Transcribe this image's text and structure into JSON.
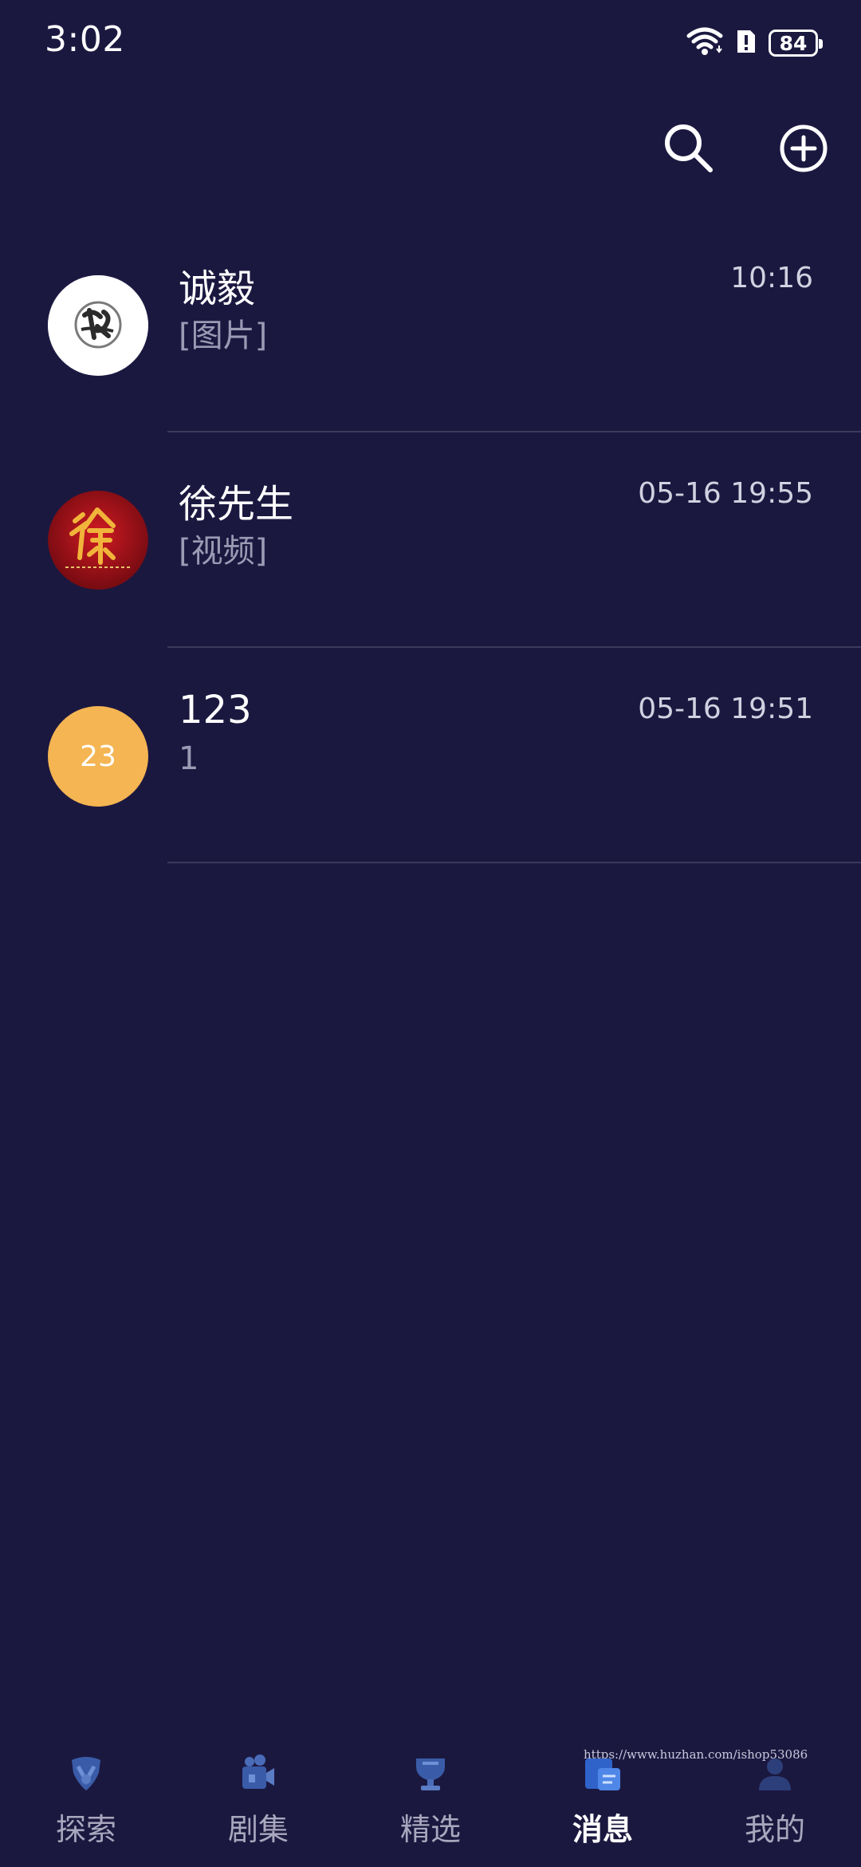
{
  "status_bar": {
    "time": "3:02",
    "battery": "84",
    "icons": [
      "wifi-icon",
      "alert-icon",
      "battery-icon"
    ]
  },
  "header": {
    "actions": [
      {
        "icon": "search-icon"
      },
      {
        "icon": "add-circle-icon"
      }
    ]
  },
  "conversations": [
    {
      "name": "诚毅",
      "time": "10:16",
      "preview": "[图片]",
      "avatar": "seal-avatar"
    },
    {
      "name": "徐先生",
      "time": "05-16 19:55",
      "preview": "[视频]",
      "avatar": "calligraphy-avatar"
    },
    {
      "name": "123",
      "time": "05-16 19:51",
      "preview": "1",
      "avatar_text": "23",
      "avatar_color": "#f4b552"
    }
  ],
  "bottom_nav": {
    "items": [
      {
        "label": "探索",
        "icon": "explore-icon"
      },
      {
        "label": "剧集",
        "icon": "series-icon"
      },
      {
        "label": "精选",
        "icon": "featured-icon"
      },
      {
        "label": "消息",
        "icon": "message-icon",
        "active": true
      },
      {
        "label": "我的",
        "icon": "profile-icon"
      }
    ]
  },
  "watermark": "https://www.huzhan.com/ishop53086",
  "colors": {
    "background": "#1b1840",
    "accent_avatar": "#f4b552",
    "divider": "#3c3a5c"
  }
}
